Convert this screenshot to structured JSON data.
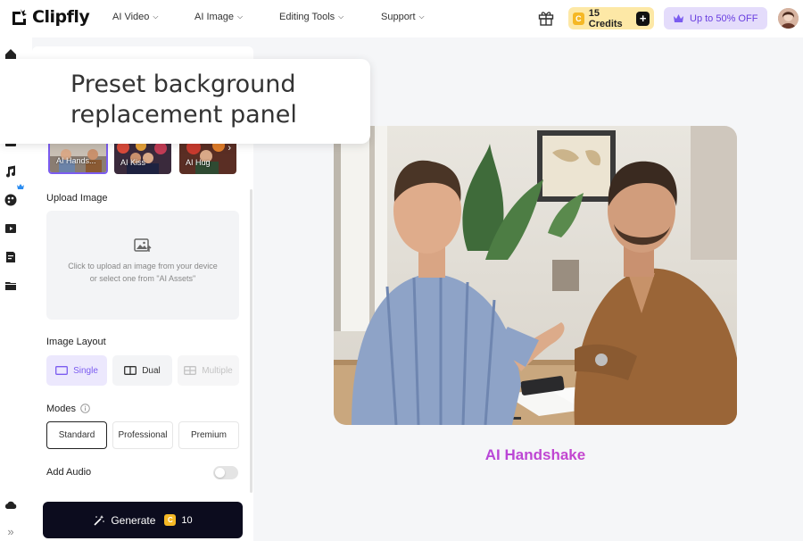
{
  "brand": {
    "name": "Clipfly"
  },
  "nav": {
    "items": [
      {
        "label": "AI Video"
      },
      {
        "label": "AI Image"
      },
      {
        "label": "Editing Tools"
      },
      {
        "label": "Support"
      }
    ],
    "credits_label": "15 Credits",
    "credits_coin": "C",
    "credits_plus": "+",
    "promo_label": "Up to 50% OFF"
  },
  "rail": {
    "icons": [
      "home-icon",
      "image-icon",
      "music-icon",
      "palette-icon",
      "video-icon",
      "document-icon",
      "folder-icon",
      "cloud-icon",
      "expand-icon"
    ]
  },
  "panel": {
    "presets": [
      {
        "label": "AI Hands..."
      },
      {
        "label": "AI Kiss"
      },
      {
        "label": "AI Hug"
      }
    ],
    "upload_label": "Upload Image",
    "upload_text": "Click to upload an image from your device or select one from \"AI Assets\"",
    "layout_label": "Image Layout",
    "layouts": [
      {
        "label": "Single",
        "state": "selected"
      },
      {
        "label": "Dual",
        "state": "default"
      },
      {
        "label": "Multiple",
        "state": "disabled"
      }
    ],
    "modes_label": "Modes",
    "modes": [
      {
        "label": "Standard",
        "state": "selected"
      },
      {
        "label": "Professional",
        "state": "default"
      },
      {
        "label": "Premium",
        "state": "default"
      }
    ],
    "audio_label": "Add Audio",
    "audio_enabled": false,
    "generate_label": "Generate",
    "generate_cost": "10",
    "generate_coin": "C"
  },
  "preview": {
    "title": "AI Handshake"
  },
  "callout": {
    "text": "Preset background replacement panel"
  },
  "colors": {
    "accent": "#7b5cf0",
    "credits_bg": "#fde8a6",
    "promo_bg": "#e4dcfb",
    "generate_bg": "#0c0c1e",
    "title_gradient_start": "#a347e6",
    "title_gradient_end": "#d944c0"
  }
}
